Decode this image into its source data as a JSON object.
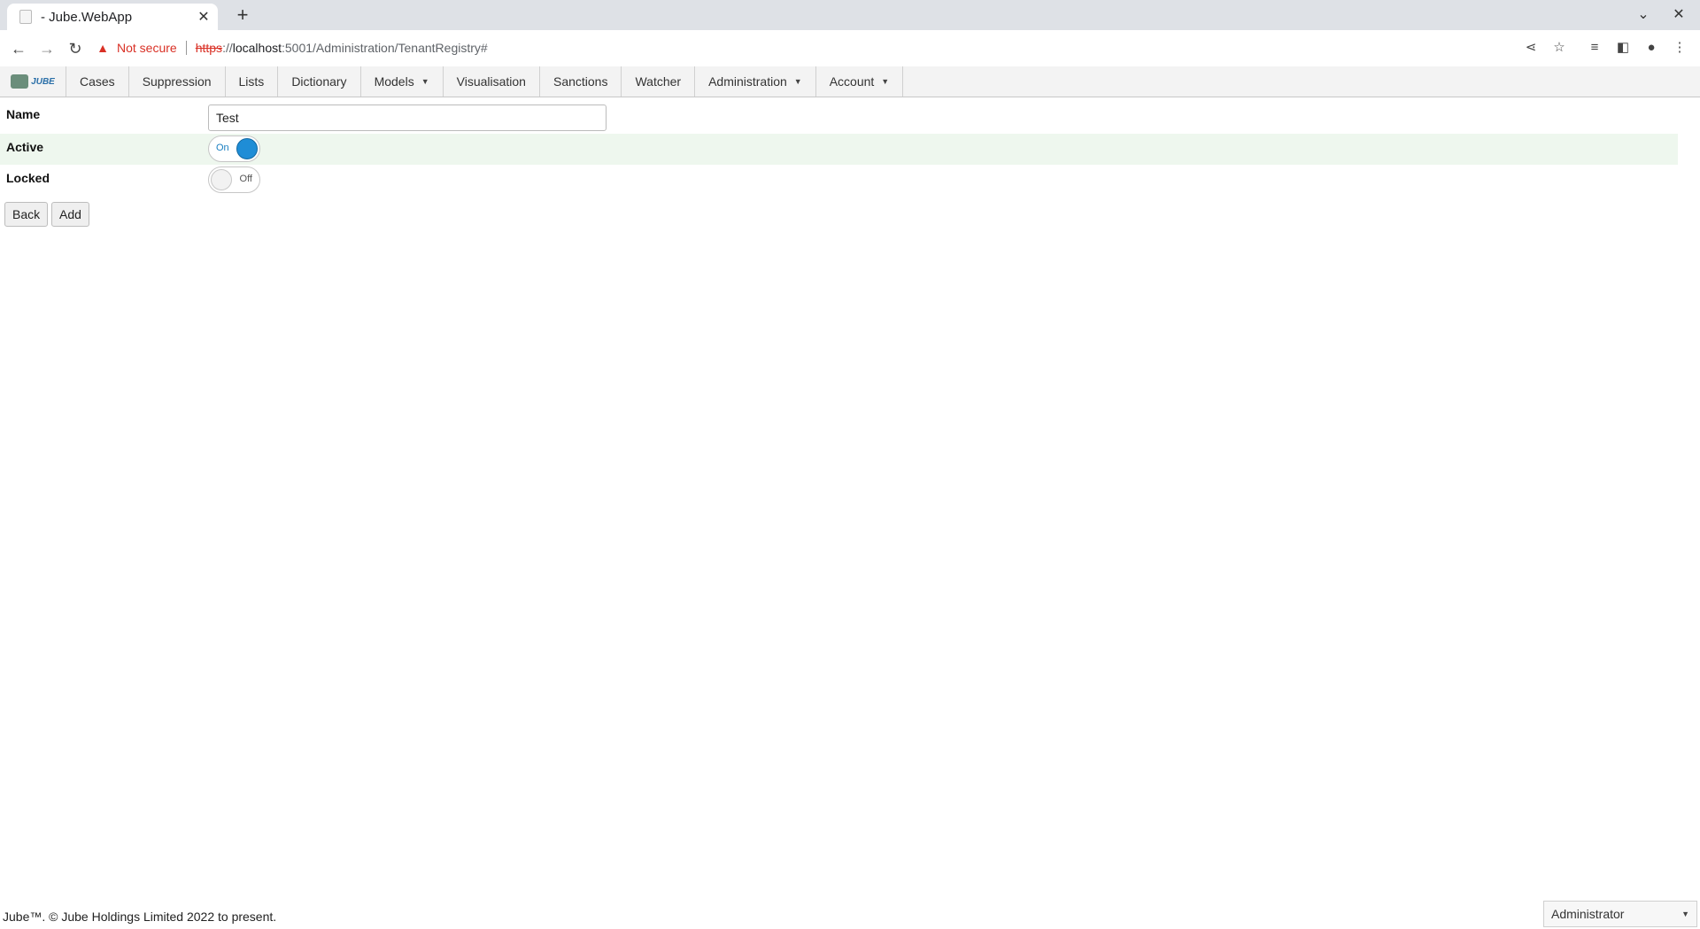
{
  "browser": {
    "tab_title": "- Jube.WebApp",
    "tab_close": "✕",
    "new_tab": "+",
    "security_label": "Not secure",
    "url_scheme": "https",
    "url_host": "localhost",
    "url_rest": ":5001/Administration/TenantRegistry#"
  },
  "nav": {
    "items": [
      {
        "label": "Cases"
      },
      {
        "label": "Suppression"
      },
      {
        "label": "Lists"
      },
      {
        "label": "Dictionary"
      },
      {
        "label": "Models",
        "dropdown": true
      },
      {
        "label": "Visualisation"
      },
      {
        "label": "Sanctions"
      },
      {
        "label": "Watcher"
      },
      {
        "label": "Administration",
        "dropdown": true
      },
      {
        "label": "Account",
        "dropdown": true
      }
    ],
    "logo_text": "JUBE"
  },
  "form": {
    "name_label": "Name",
    "name_value": "Test",
    "active_label": "Active",
    "active_state": "On",
    "locked_label": "Locked",
    "locked_state": "Off",
    "back_label": "Back",
    "add_label": "Add"
  },
  "footer": {
    "copyright": "Jube™. © Jube Holdings Limited 2022 to present.",
    "user_role": "Administrator"
  },
  "colors": {
    "active_row": "#eef7ee",
    "toggle_on": "#1f8dd6"
  }
}
